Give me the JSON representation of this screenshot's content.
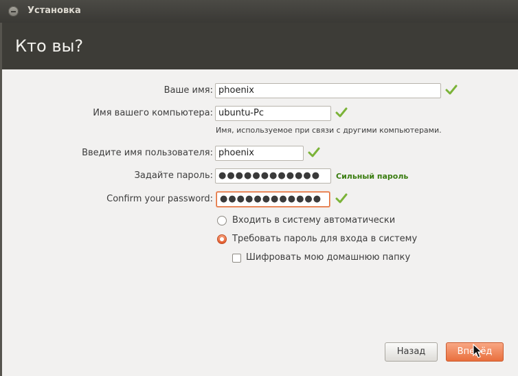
{
  "window": {
    "title": "Установка"
  },
  "header": {
    "title": "Кто вы?"
  },
  "form": {
    "name_label": "Ваше имя:",
    "name_value": "phoenix",
    "computer_label": "Имя вашего компьютера:",
    "computer_value": "ubuntu-Pc",
    "computer_hint": "Имя, используемое при связи с другими компьютерами.",
    "username_label": "Введите имя пользователя:",
    "username_value": "phoenix",
    "password_label": "Задайте пароль:",
    "password_value": "●●●●●●●●●●●●",
    "password_strength": "Сильный пароль",
    "confirm_label": "Confirm your password:",
    "confirm_value": "●●●●●●●●●●●●"
  },
  "options": {
    "auto_login_label": "Входить в систему автоматически",
    "require_password_label": "Требовать пароль для входа в систему",
    "encrypt_home_label": "Шифровать мою домашнюю папку",
    "selected": "require_password",
    "encrypt_home_checked": false
  },
  "buttons": {
    "back_label": "Назад",
    "next_label": "Вперёд"
  },
  "colors": {
    "accent": "#e96f3d",
    "check_green": "#7bb338",
    "strength_green": "#3a7d10"
  },
  "icons": {
    "valid": "check-icon",
    "close": "close-icon",
    "cursor": "mouse-cursor-icon"
  }
}
